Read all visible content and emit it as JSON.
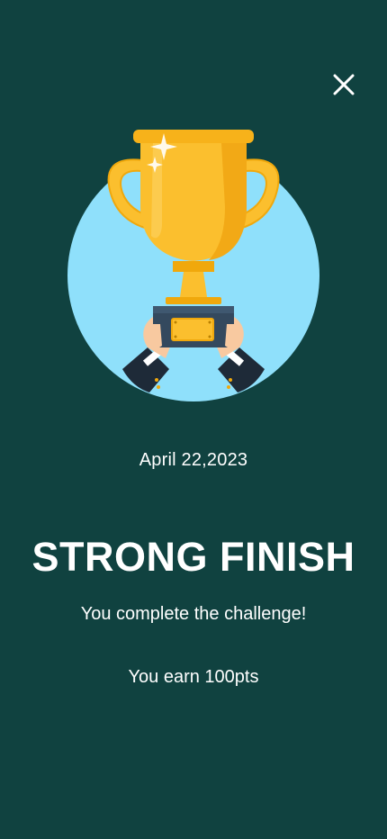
{
  "icons": {
    "close": "close-icon",
    "trophy": "trophy-illustration"
  },
  "colors": {
    "background": "#104240",
    "circle": "#8FE0FB",
    "trophy_gold": "#FBBF2E",
    "trophy_dark_gold": "#F0A80C",
    "text": "#FFFFFF"
  },
  "result": {
    "date": "April 22,2023",
    "title": "STRONG FINISH",
    "message": "You complete the challenge!",
    "points_text": "You earn 100pts"
  }
}
